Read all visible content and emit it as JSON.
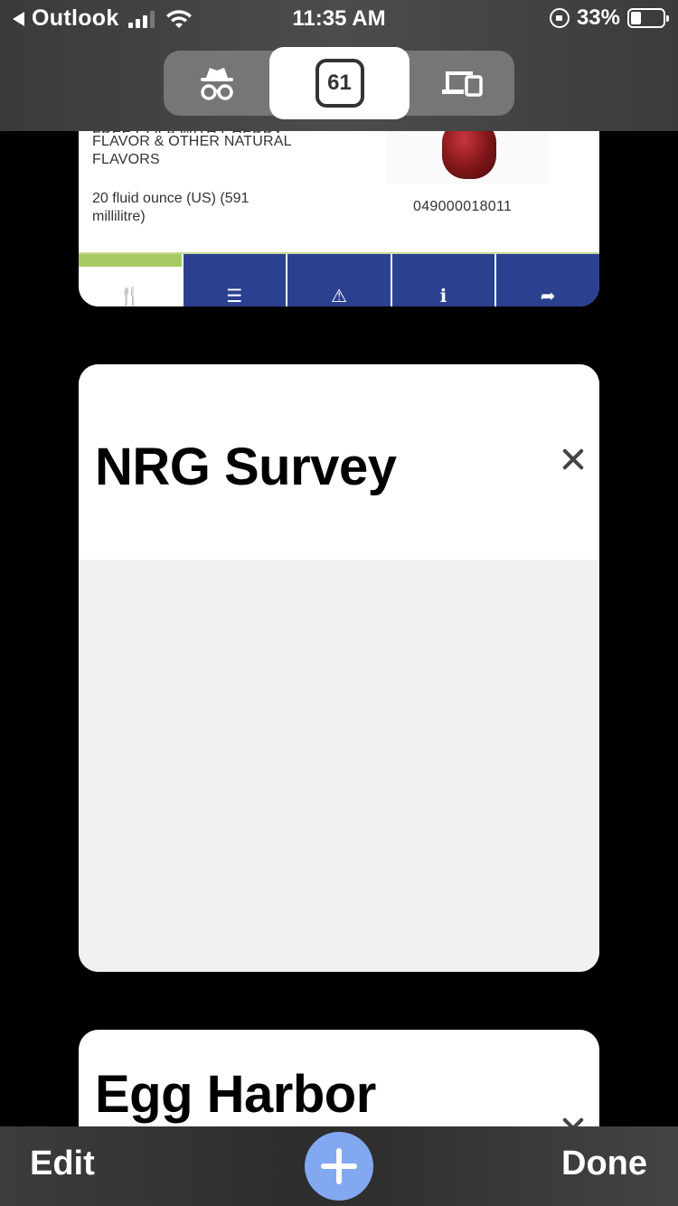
{
  "status_bar": {
    "back_app": "Outlook",
    "time": "11:35 AM",
    "battery": "33%"
  },
  "tab_switcher": {
    "private_icon": "incognito-icon",
    "tab_count": "61",
    "devices_icon": "devices-icon"
  },
  "tabs": [
    {
      "product_desc_clipped": "FREE COLA WITH CHERRY",
      "product_desc_line1": "FLAVOR & OTHER NATURAL",
      "product_desc_line2": "FLAVORS",
      "product_size_line1": "20 fluid ounce (US) (591",
      "product_size_line2": "millilitre)",
      "barcode": "049000018011",
      "nav_icons": [
        "utensils-icon",
        "list-icon",
        "warning-icon",
        "info-icon",
        "share-icon"
      ]
    },
    {
      "title": "NRG Survey"
    },
    {
      "title": "Egg Harbor"
    }
  ],
  "toolbar": {
    "edit_label": "Edit",
    "done_label": "Done"
  }
}
